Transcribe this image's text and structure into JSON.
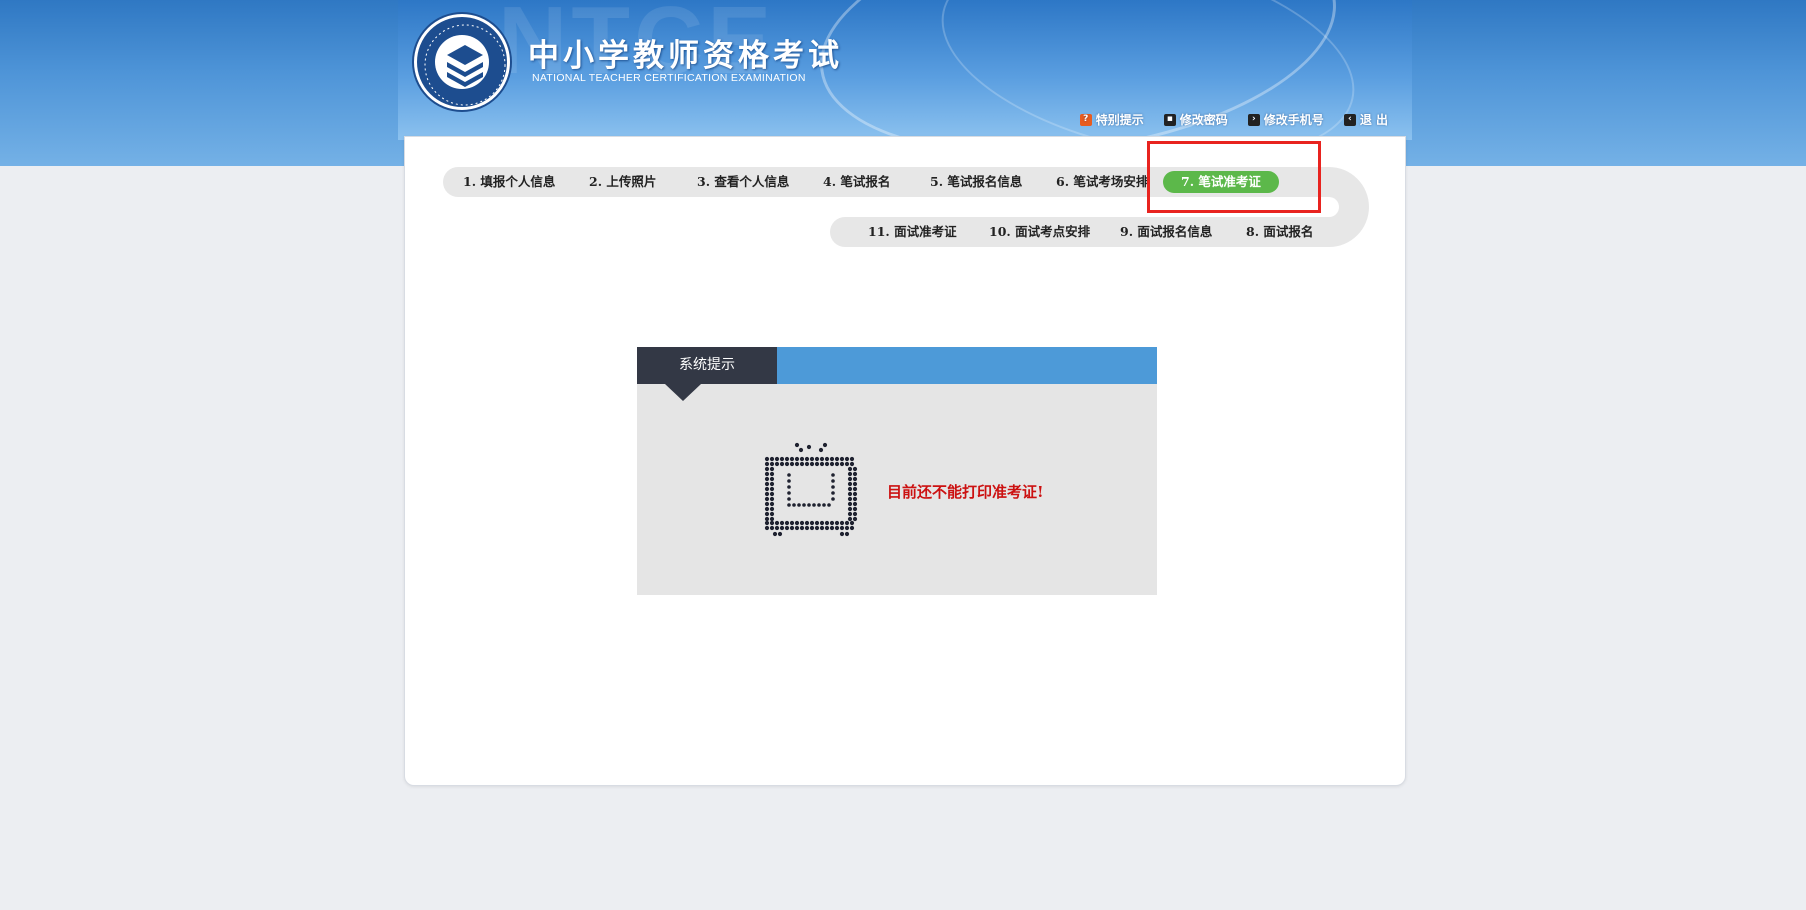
{
  "header": {
    "title": "中小学教师资格考试",
    "subtitle": "NATIONAL TEACHER CERTIFICATION EXAMINATION",
    "watermark": "NTCE",
    "top_links": [
      {
        "label": "特别提示",
        "icon": "warning-icon"
      },
      {
        "label": "修改密码",
        "icon": "password-icon"
      },
      {
        "label": "修改手机号",
        "icon": "phone-icon"
      },
      {
        "label": "退 出",
        "icon": "exit-icon"
      }
    ]
  },
  "steps": {
    "row1": [
      "1. 填报个人信息",
      "2. 上传照片",
      "3. 查看个人信息",
      "4. 笔试报名",
      "5. 笔试报名信息",
      "6. 笔试考场安排",
      "7. 笔试准考证"
    ],
    "row2": [
      "11. 面试准考证",
      "10. 面试考点安排",
      "9. 面试报名信息",
      "8. 面试报名"
    ],
    "active_step": "7. 笔试准考证"
  },
  "notice": {
    "tab_title": "系统提示",
    "message": "目前还不能打印准考证!"
  },
  "colors": {
    "header_blue": "#4f95d8",
    "active_step_green": "#5cb84a",
    "message_red": "#cc1111",
    "highlight_red": "#e8231f",
    "tab_dark": "#333845"
  }
}
